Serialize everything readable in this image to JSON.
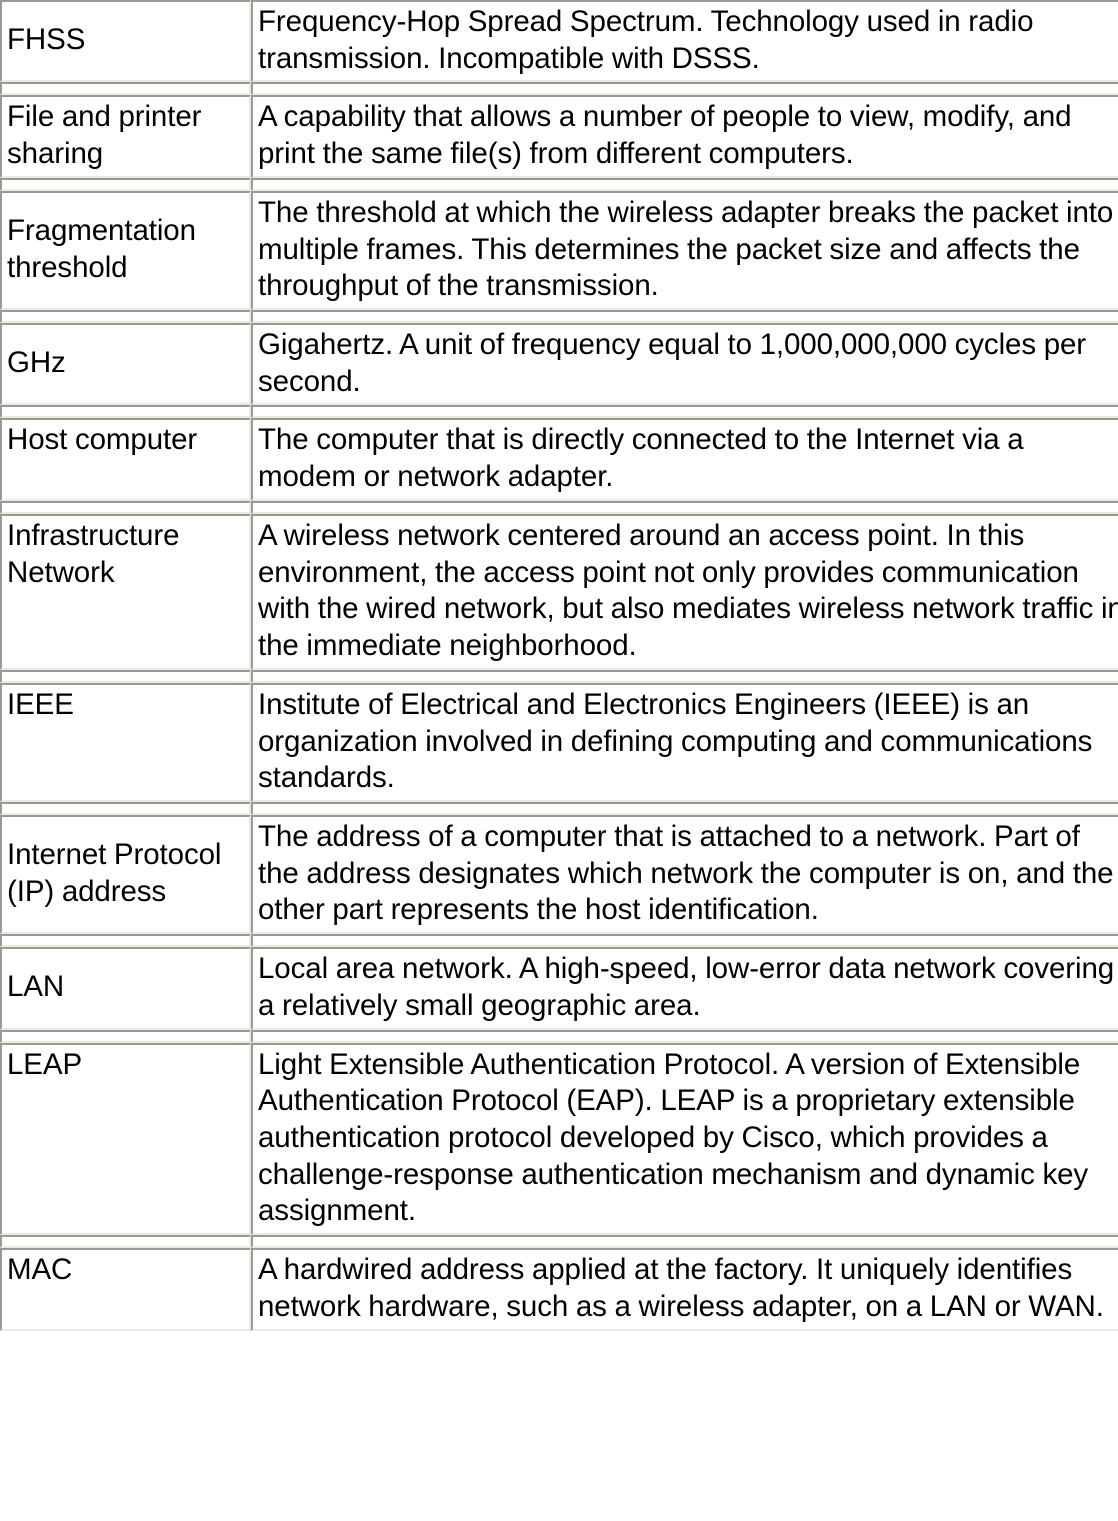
{
  "document": {
    "type": "glossary-table",
    "column_count": 2,
    "row_count": 10,
    "text_color": "#000000",
    "background_color": "#ffffff",
    "border_color": "#9a9a94",
    "border_highlight_color": "#e9e9e4"
  },
  "rows": [
    {
      "term": "FHSS",
      "definition": "Frequency-Hop Spread Spectrum. Technology used in radio transmission. Incompatible with DSSS."
    },
    {
      "term": "File and printer sharing",
      "definition": "A capability that allows a number of people to view, modify, and print the same file(s) from different computers."
    },
    {
      "term": "Fragmentation threshold",
      "definition": "The threshold at which the wireless adapter breaks the packet into multiple frames. This determines the packet size and affects the throughput of the transmission."
    },
    {
      "term": "GHz",
      "definition": "Gigahertz. A unit of frequency equal to 1,000,000,000 cycles per second."
    },
    {
      "term": "Host computer",
      "definition": "The computer that is directly connected to the Internet via a modem or network adapter."
    },
    {
      "term": "Infrastructure Network",
      "definition": "A wireless network centered around an access point. In this environment, the access point not only provides communication with the wired network, but also mediates wireless network traffic in the immediate neighborhood."
    },
    {
      "term": "IEEE",
      "definition": "Institute of Electrical and Electronics Engineers (IEEE) is an organization involved in defining computing and communications standards."
    },
    {
      "term": "Internet Protocol (IP) address",
      "definition": "The address of a computer that is attached to a network. Part of the address designates which network the computer is on, and the other part represents the host identification."
    },
    {
      "term": "LAN",
      "definition": "Local area network. A high-speed, low-error data network covering a relatively small geographic area."
    },
    {
      "term": "LEAP",
      "definition": "Light Extensible Authentication Protocol. A version of Extensible Authentication Protocol (EAP). LEAP is a proprietary extensible authentication protocol developed by Cisco, which provides a challenge-response authentication mechanism and dynamic key assignment."
    },
    {
      "term": "MAC",
      "definition": "A hardwired address applied at the factory. It uniquely identifies network hardware, such as a wireless adapter, on a LAN or WAN."
    }
  ]
}
